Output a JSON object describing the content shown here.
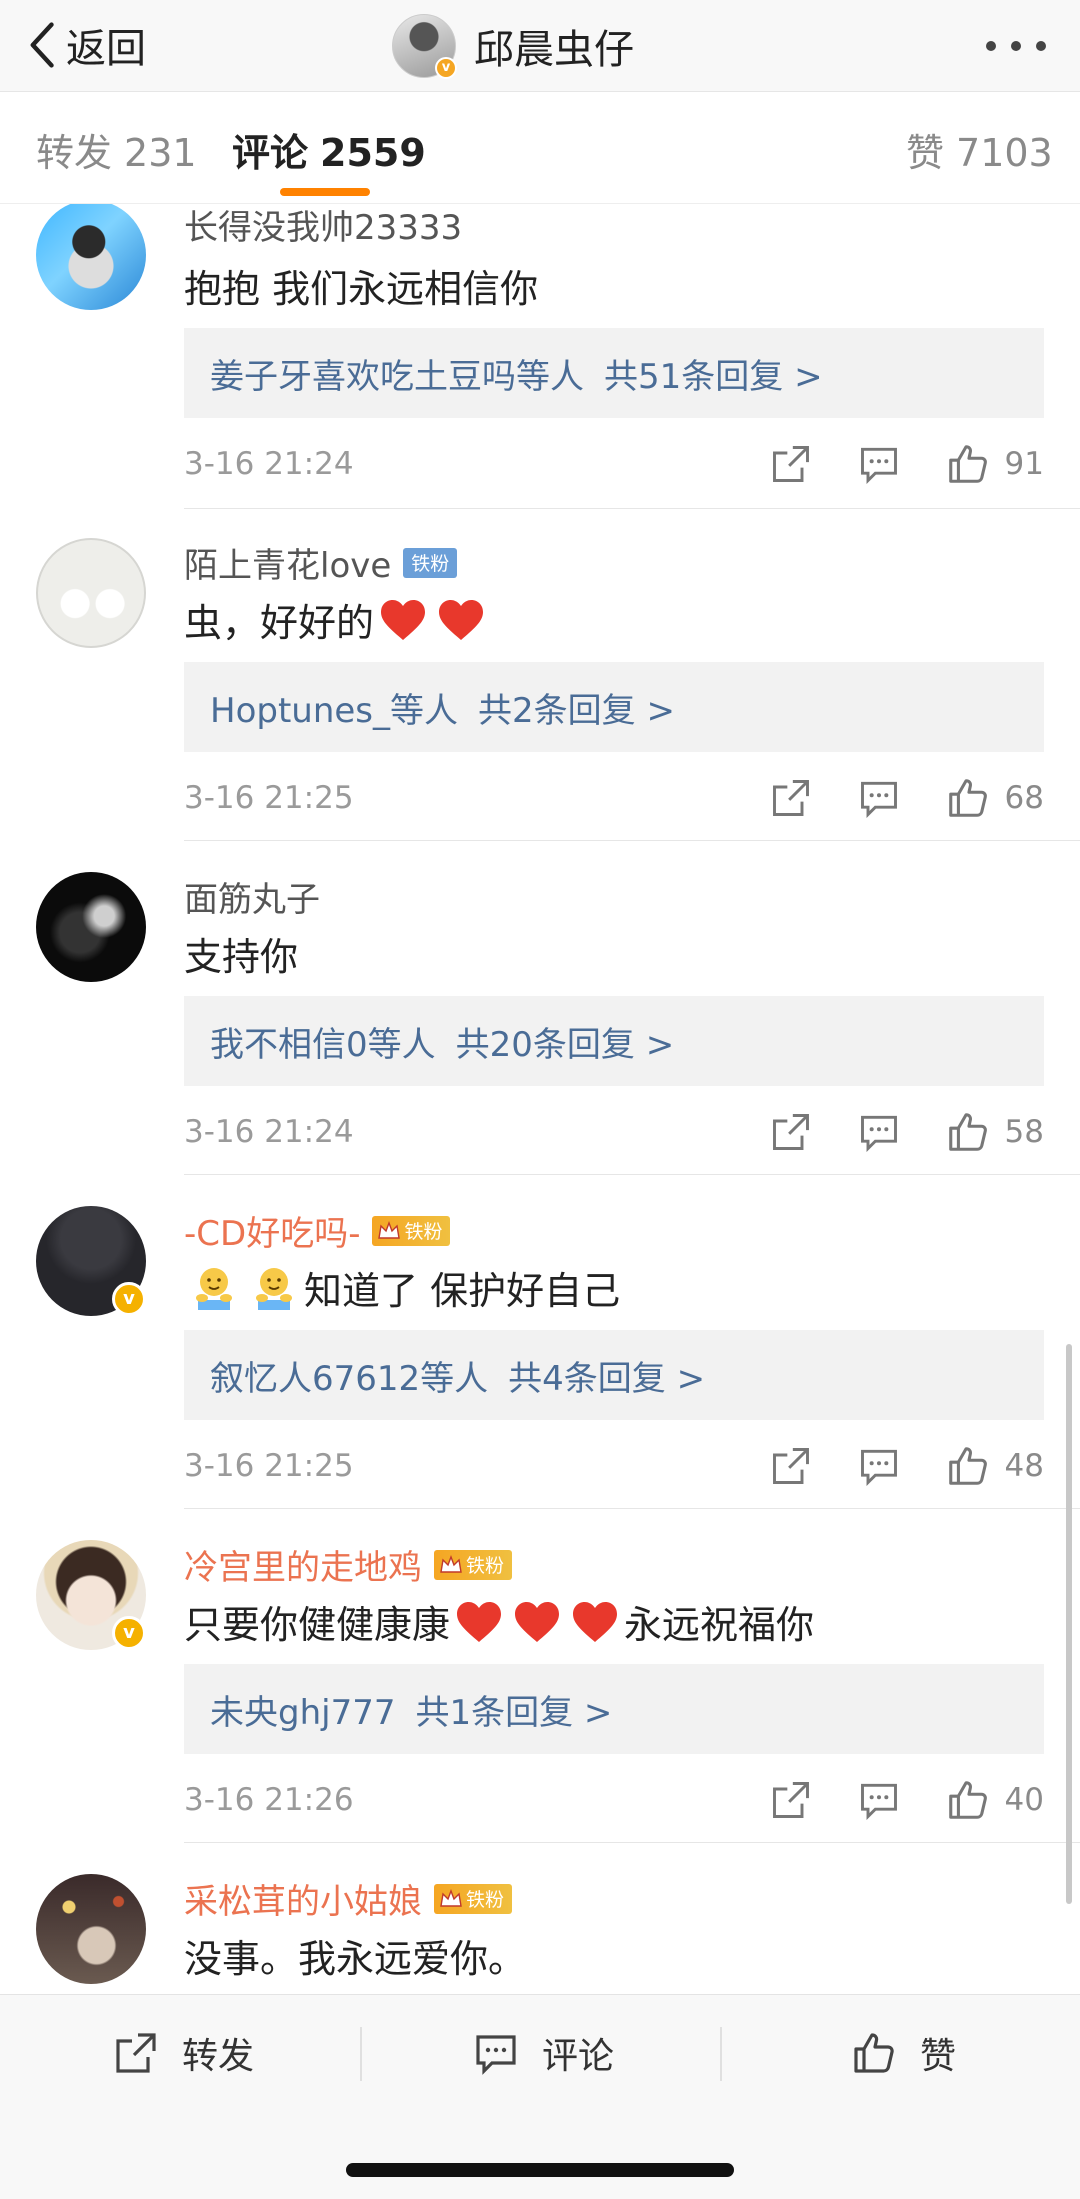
{
  "nav": {
    "back_label": "返回",
    "title": "邱晨虫仔"
  },
  "tabs": [
    {
      "label": "转发",
      "count": "231"
    },
    {
      "label": "评论",
      "count": "2559"
    },
    {
      "label": "赞",
      "count": "7103"
    }
  ],
  "comments": [
    {
      "user": "长得没我帅23333",
      "text": "抱抱 我们永远相信你",
      "replies": "姜子牙喜欢吃土豆吗等人",
      "reply_count": "共51条回复 >",
      "time": "3-16 21:24",
      "likes": "91"
    },
    {
      "user": "陌上青花love",
      "badge": "铁粉",
      "text": "虫，好好的",
      "replies": "Hoptunes_等人",
      "reply_count": "共2条回复 >",
      "time": "3-16 21:25",
      "likes": "68"
    },
    {
      "user": "面筋丸子",
      "text": "支持你",
      "replies": "我不相信0等人",
      "reply_count": "共20条回复 >",
      "time": "3-16 21:24",
      "likes": "58"
    },
    {
      "user": "-CD好吃吗-",
      "badge": "铁粉",
      "text": "知道了 保护好自己",
      "replies": "叙忆人67612等人",
      "reply_count": "共4条回复 >",
      "time": "3-16 21:25",
      "likes": "48"
    },
    {
      "user": "冷宫里的走地鸡",
      "badge": "铁粉",
      "text_after": "永远祝福你",
      "text_before": "只要你健健康康",
      "replies": "未央ghj777",
      "reply_count": "共1条回复 >",
      "time": "3-16 21:26",
      "likes": "40"
    },
    {
      "user": "采松茸的小姑娘",
      "badge": "铁粉",
      "text": "没事。我永远爱你。"
    }
  ],
  "bottom": {
    "repost": "转发",
    "comment": "评论",
    "like": "赞"
  },
  "colors": {
    "accent": "#ff8200",
    "link": "#4a6c96",
    "vip_name": "#eb7350",
    "heart": "#e8382c"
  }
}
